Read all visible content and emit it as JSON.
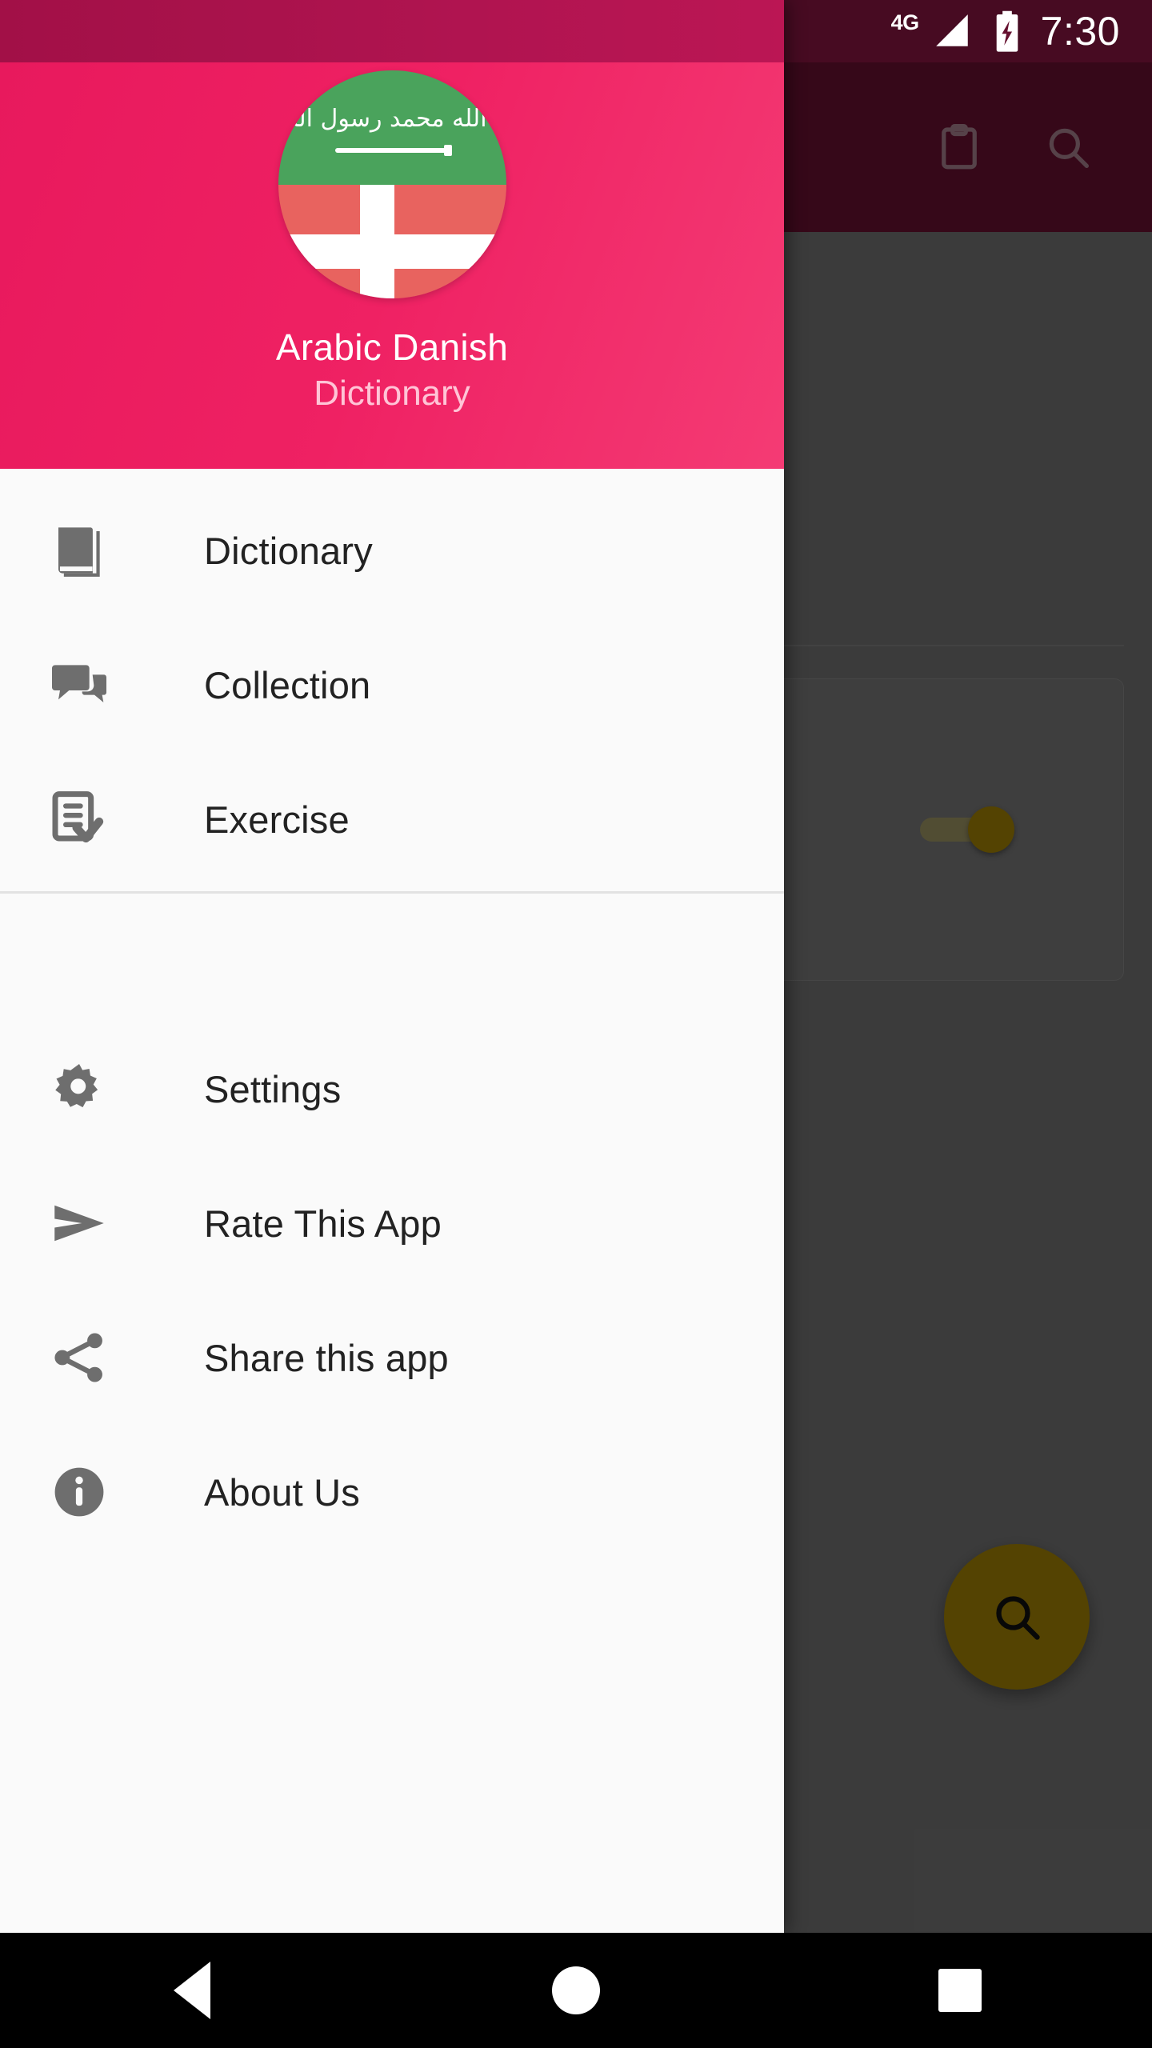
{
  "status_bar": {
    "network_label": "4G",
    "time": "7:30",
    "signal_icon": "signal-bars-icon",
    "battery_icon": "battery-charging-icon"
  },
  "background_app": {
    "toolbar": {
      "actions": [
        {
          "name": "clipboard-icon",
          "label": "Clipboard"
        },
        {
          "name": "search-icon",
          "label": "Search"
        }
      ]
    },
    "refresh_icon": "refresh-icon",
    "toggle": {
      "state": "on",
      "name": "toggle-switch"
    },
    "fab": {
      "icon": "search-icon",
      "label": "Search"
    }
  },
  "drawer": {
    "header": {
      "title": "Arabic  Danish",
      "subtitle": "Dictionary",
      "avatar_name": "flag-avatar-arabic-danish"
    },
    "primary_items": [
      {
        "label": "Dictionary",
        "icon": "book-icon"
      },
      {
        "label": "Collection",
        "icon": "chat-bubbles-icon"
      },
      {
        "label": "Exercise",
        "icon": "document-check-icon"
      }
    ],
    "secondary_items": [
      {
        "label": "Settings",
        "icon": "gear-icon"
      },
      {
        "label": "Rate This App",
        "icon": "send-arrow-icon"
      },
      {
        "label": "Share this app",
        "icon": "share-icon"
      },
      {
        "label": "About Us",
        "icon": "info-icon"
      }
    ]
  },
  "navigation_bar": {
    "buttons": [
      {
        "name": "back-button",
        "label": "Back"
      },
      {
        "name": "home-button",
        "label": "Home"
      },
      {
        "name": "recents-button",
        "label": "Recents"
      }
    ]
  },
  "colors": {
    "accent_pink": "#ef2163",
    "status_pink": "#a21047",
    "toolbar_maroon": "#65102f",
    "fab_amber": "#9c7c04",
    "drawer_bg": "#fafafa"
  }
}
